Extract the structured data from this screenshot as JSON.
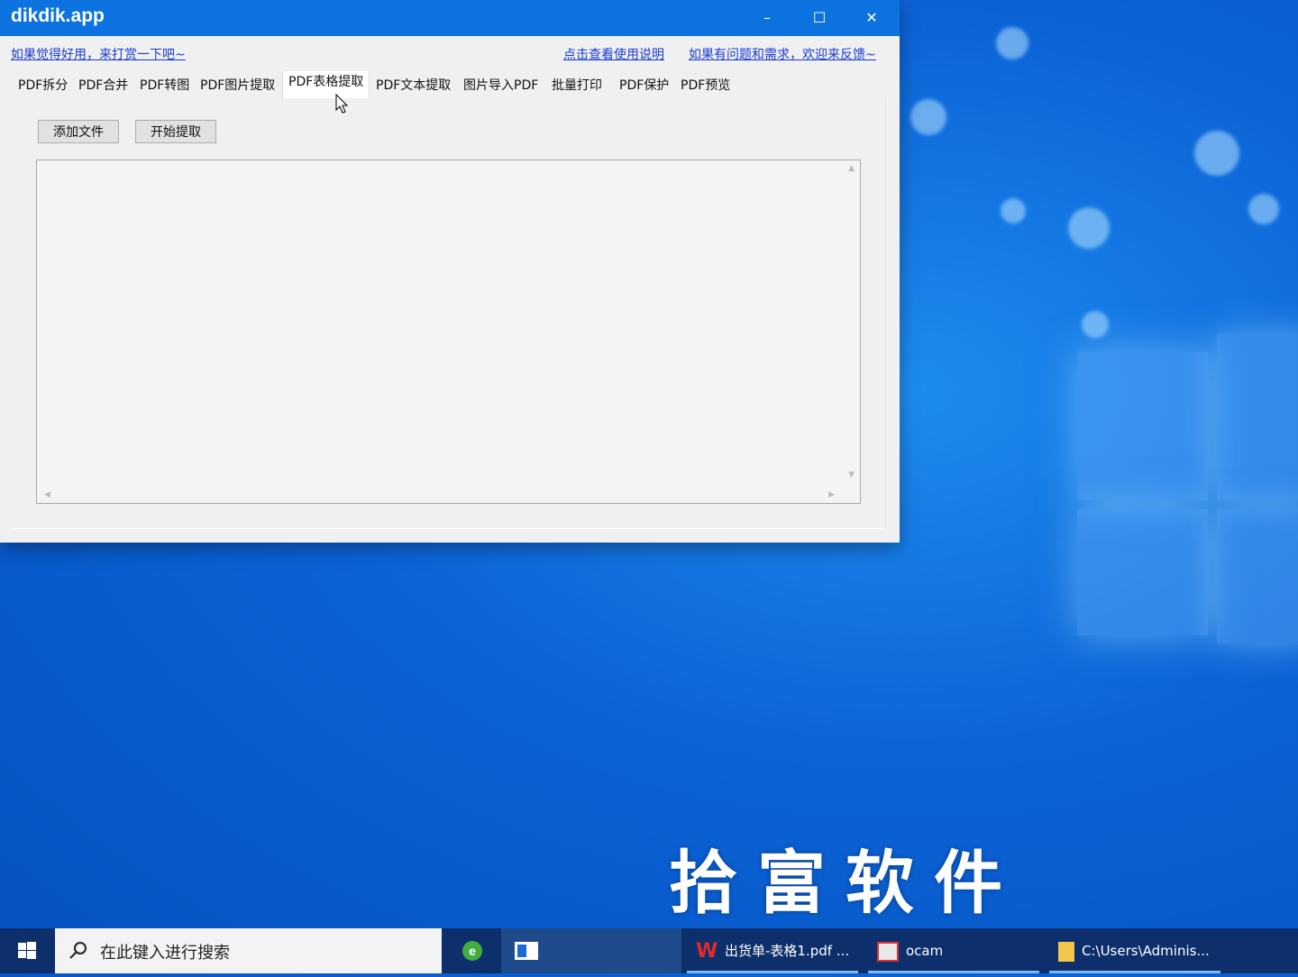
{
  "window": {
    "title": "dikdik.app",
    "controls": {
      "minimize": "–",
      "maximize": "☐",
      "close": "✕"
    }
  },
  "links": {
    "left": "如果觉得好用，来打赏一下吧~",
    "help": "点击查看使用说明",
    "feedback": "如果有问题和需求，欢迎来反馈~"
  },
  "tabs": [
    {
      "label": "PDF拆分"
    },
    {
      "label": "PDF合并"
    },
    {
      "label": "PDF转图"
    },
    {
      "label": "PDF图片提取"
    },
    {
      "label": "PDF表格提取",
      "active": true
    },
    {
      "label": "PDF文本提取"
    },
    {
      "label": "图片导入PDF"
    },
    {
      "label": "批量打印"
    },
    {
      "label": "PDF保护"
    },
    {
      "label": "PDF预览"
    }
  ],
  "buttons": {
    "add_file": "添加文件",
    "start": "开始提取"
  },
  "watermark": "拾富软件",
  "taskbar": {
    "search_placeholder": "在此键入进行搜索",
    "items": [
      {
        "label": "出货单-表格1.pdf ...",
        "icon": "wps-icon"
      },
      {
        "label": "ocam",
        "icon": "ocam-icon"
      },
      {
        "label": "C:\\Users\\Adminis...",
        "icon": "folder-icon"
      }
    ]
  },
  "colors": {
    "titlebar": "#0b72e0",
    "link": "#1a3bd6",
    "taskbar": "#0d2f6b",
    "desktop": "#0b63d6"
  }
}
